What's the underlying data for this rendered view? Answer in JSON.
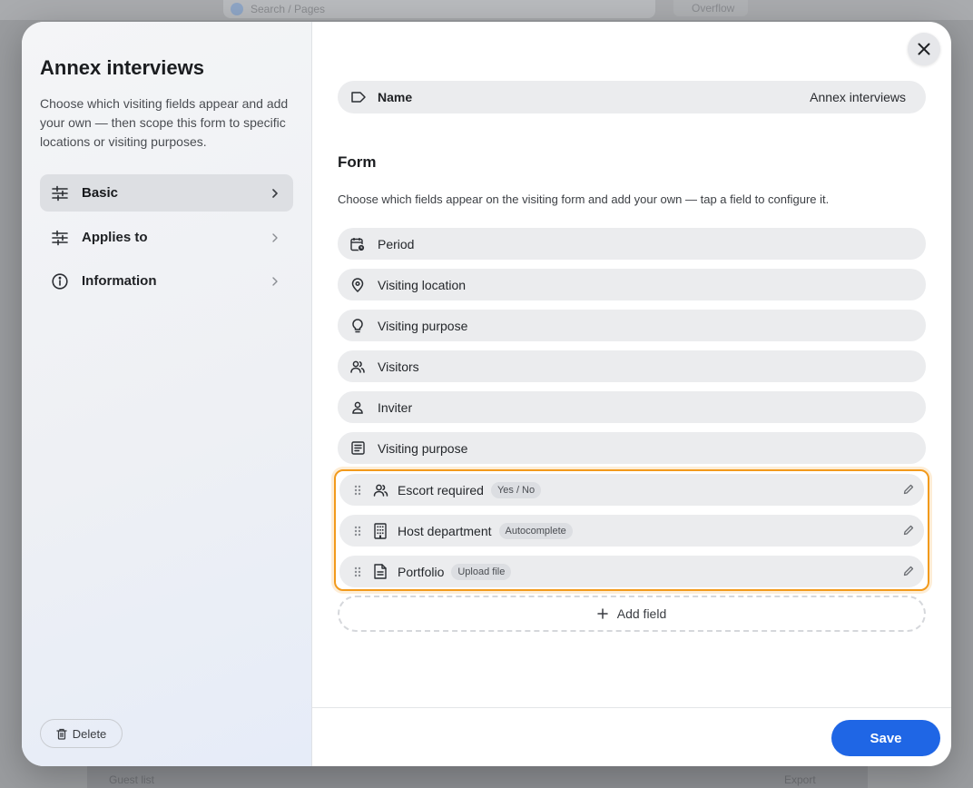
{
  "background": {
    "search_placeholder": "Search / Pages",
    "top_right_label": "Overflow",
    "bottom_left_label": "Guest list",
    "bottom_right_label": "Export"
  },
  "sidebar": {
    "title": "Annex interviews",
    "description": "Choose which visiting fields appear and add your own — then scope this form to specific locations or visiting purposes.",
    "items": [
      {
        "label": "Basic",
        "icon": "sliders-icon",
        "active": true
      },
      {
        "label": "Applies to",
        "icon": "sliders-icon",
        "active": false
      },
      {
        "label": "Information",
        "icon": "info-icon",
        "active": false
      }
    ],
    "delete_label": "Delete"
  },
  "main": {
    "name_label": "Name",
    "name_value": "Annex interviews",
    "form_title": "Form",
    "form_description": "Choose which fields appear on the visiting form and add your own — tap a field to configure it.",
    "fields": [
      {
        "label": "Period",
        "icon": "calendar-clock-icon"
      },
      {
        "label": "Visiting location",
        "icon": "location-pin-icon"
      },
      {
        "label": "Visiting purpose",
        "icon": "lightbulb-icon"
      },
      {
        "label": "Visitors",
        "icon": "people-icon"
      },
      {
        "label": "Inviter",
        "icon": "person-icon"
      },
      {
        "label": "Visiting purpose",
        "icon": "notes-icon"
      }
    ],
    "custom_fields": [
      {
        "label": "Escort required",
        "badge": "Yes / No",
        "icon": "people-icon"
      },
      {
        "label": "Host department",
        "badge": "Autocomplete",
        "icon": "building-icon"
      },
      {
        "label": "Portfolio",
        "badge": "Upload file",
        "icon": "document-icon"
      }
    ],
    "add_field_label": "Add field",
    "save_label": "Save"
  },
  "colors": {
    "accent": "#1f66e5",
    "highlight": "#f29a1c"
  }
}
